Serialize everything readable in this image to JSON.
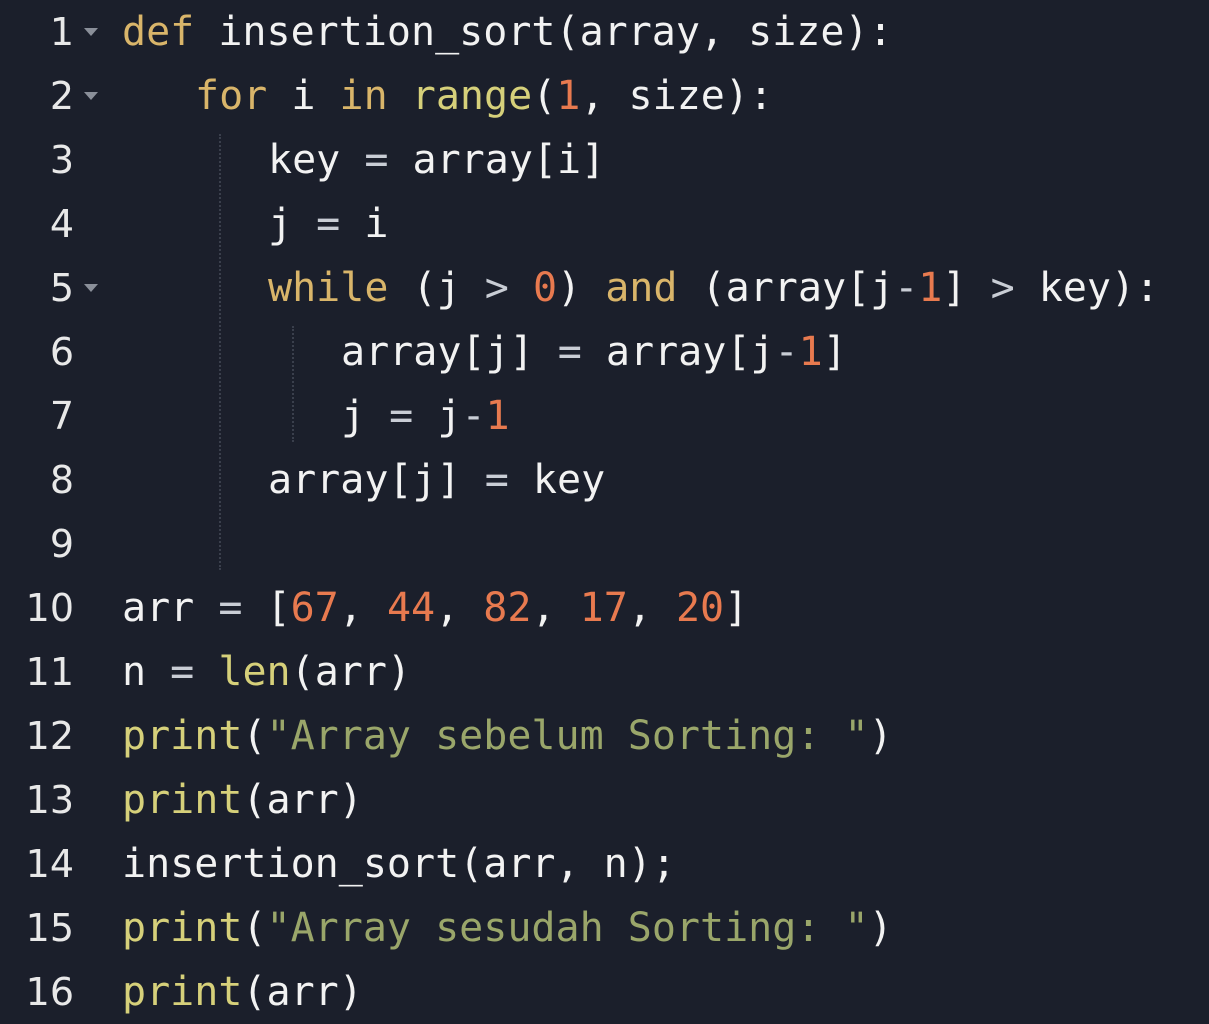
{
  "editor": {
    "language": "python",
    "colors": {
      "background": "#1b1f2b",
      "keyword": "#d9b56a",
      "builtin": "#d6d07a",
      "number": "#e87a4f",
      "string": "#9aa66a",
      "text": "#f2f2f2",
      "line_number": "#e8e8e8"
    },
    "fold_icon": "chevron-down-icon",
    "lines": [
      {
        "n": "1",
        "fold": true,
        "indent": 0,
        "tokens": [
          {
            "t": "kw",
            "v": "def"
          },
          {
            "t": "tx",
            "v": " insertion_sort(array, size):"
          }
        ]
      },
      {
        "n": "2",
        "fold": true,
        "indent": 1,
        "tokens": [
          {
            "t": "kw",
            "v": "for"
          },
          {
            "t": "tx",
            "v": " i "
          },
          {
            "t": "kw",
            "v": "in"
          },
          {
            "t": "tx",
            "v": " "
          },
          {
            "t": "fn",
            "v": "range"
          },
          {
            "t": "tx",
            "v": "("
          },
          {
            "t": "num",
            "v": "1"
          },
          {
            "t": "tx",
            "v": ", size):"
          }
        ]
      },
      {
        "n": "3",
        "fold": false,
        "indent": 2,
        "tokens": [
          {
            "t": "tx",
            "v": "key "
          },
          {
            "t": "op",
            "v": "="
          },
          {
            "t": "tx",
            "v": " array[i]"
          }
        ]
      },
      {
        "n": "4",
        "fold": false,
        "indent": 2,
        "tokens": [
          {
            "t": "tx",
            "v": "j "
          },
          {
            "t": "op",
            "v": "="
          },
          {
            "t": "tx",
            "v": " i"
          }
        ]
      },
      {
        "n": "5",
        "fold": true,
        "indent": 2,
        "tokens": [
          {
            "t": "kw",
            "v": "while"
          },
          {
            "t": "tx",
            "v": " (j "
          },
          {
            "t": "op",
            "v": ">"
          },
          {
            "t": "tx",
            "v": " "
          },
          {
            "t": "num",
            "v": "0"
          },
          {
            "t": "tx",
            "v": ") "
          },
          {
            "t": "kw",
            "v": "and"
          },
          {
            "t": "tx",
            "v": " (array[j"
          },
          {
            "t": "op",
            "v": "-"
          },
          {
            "t": "num",
            "v": "1"
          },
          {
            "t": "tx",
            "v": "] "
          },
          {
            "t": "op",
            "v": ">"
          },
          {
            "t": "tx",
            "v": " key):"
          }
        ]
      },
      {
        "n": "6",
        "fold": false,
        "indent": 3,
        "tokens": [
          {
            "t": "tx",
            "v": "array[j] "
          },
          {
            "t": "op",
            "v": "="
          },
          {
            "t": "tx",
            "v": " array[j"
          },
          {
            "t": "op",
            "v": "-"
          },
          {
            "t": "num",
            "v": "1"
          },
          {
            "t": "tx",
            "v": "]"
          }
        ]
      },
      {
        "n": "7",
        "fold": false,
        "indent": 3,
        "tokens": [
          {
            "t": "tx",
            "v": "j "
          },
          {
            "t": "op",
            "v": "="
          },
          {
            "t": "tx",
            "v": " j"
          },
          {
            "t": "op",
            "v": "-"
          },
          {
            "t": "num",
            "v": "1"
          }
        ]
      },
      {
        "n": "8",
        "fold": false,
        "indent": 2,
        "tokens": [
          {
            "t": "tx",
            "v": "array[j] "
          },
          {
            "t": "op",
            "v": "="
          },
          {
            "t": "tx",
            "v": " key"
          }
        ]
      },
      {
        "n": "9",
        "fold": false,
        "indent": 0,
        "tokens": []
      },
      {
        "n": "10",
        "fold": false,
        "indent": 0,
        "tokens": [
          {
            "t": "tx",
            "v": "arr "
          },
          {
            "t": "op",
            "v": "="
          },
          {
            "t": "tx",
            "v": " ["
          },
          {
            "t": "num",
            "v": "67"
          },
          {
            "t": "tx",
            "v": ", "
          },
          {
            "t": "num",
            "v": "44"
          },
          {
            "t": "tx",
            "v": ", "
          },
          {
            "t": "num",
            "v": "82"
          },
          {
            "t": "tx",
            "v": ", "
          },
          {
            "t": "num",
            "v": "17"
          },
          {
            "t": "tx",
            "v": ", "
          },
          {
            "t": "num",
            "v": "20"
          },
          {
            "t": "tx",
            "v": "]"
          }
        ]
      },
      {
        "n": "11",
        "fold": false,
        "indent": 0,
        "tokens": [
          {
            "t": "tx",
            "v": "n "
          },
          {
            "t": "op",
            "v": "="
          },
          {
            "t": "tx",
            "v": " "
          },
          {
            "t": "fn",
            "v": "len"
          },
          {
            "t": "tx",
            "v": "(arr)"
          }
        ]
      },
      {
        "n": "12",
        "fold": false,
        "indent": 0,
        "tokens": [
          {
            "t": "fn",
            "v": "print"
          },
          {
            "t": "tx",
            "v": "("
          },
          {
            "t": "str",
            "v": "\"Array sebelum Sorting: \""
          },
          {
            "t": "tx",
            "v": ")"
          }
        ]
      },
      {
        "n": "13",
        "fold": false,
        "indent": 0,
        "tokens": [
          {
            "t": "fn",
            "v": "print"
          },
          {
            "t": "tx",
            "v": "(arr)"
          }
        ]
      },
      {
        "n": "14",
        "fold": false,
        "indent": 0,
        "tokens": [
          {
            "t": "tx",
            "v": "insertion_sort(arr, n);"
          }
        ]
      },
      {
        "n": "15",
        "fold": false,
        "indent": 0,
        "tokens": [
          {
            "t": "fn",
            "v": "print"
          },
          {
            "t": "tx",
            "v": "("
          },
          {
            "t": "str",
            "v": "\"Array sesudah Sorting: \""
          },
          {
            "t": "tx",
            "v": ")"
          }
        ]
      },
      {
        "n": "16",
        "fold": false,
        "indent": 0,
        "tokens": [
          {
            "t": "fn",
            "v": "print"
          },
          {
            "t": "tx",
            "v": "(arr)"
          }
        ]
      }
    ]
  }
}
